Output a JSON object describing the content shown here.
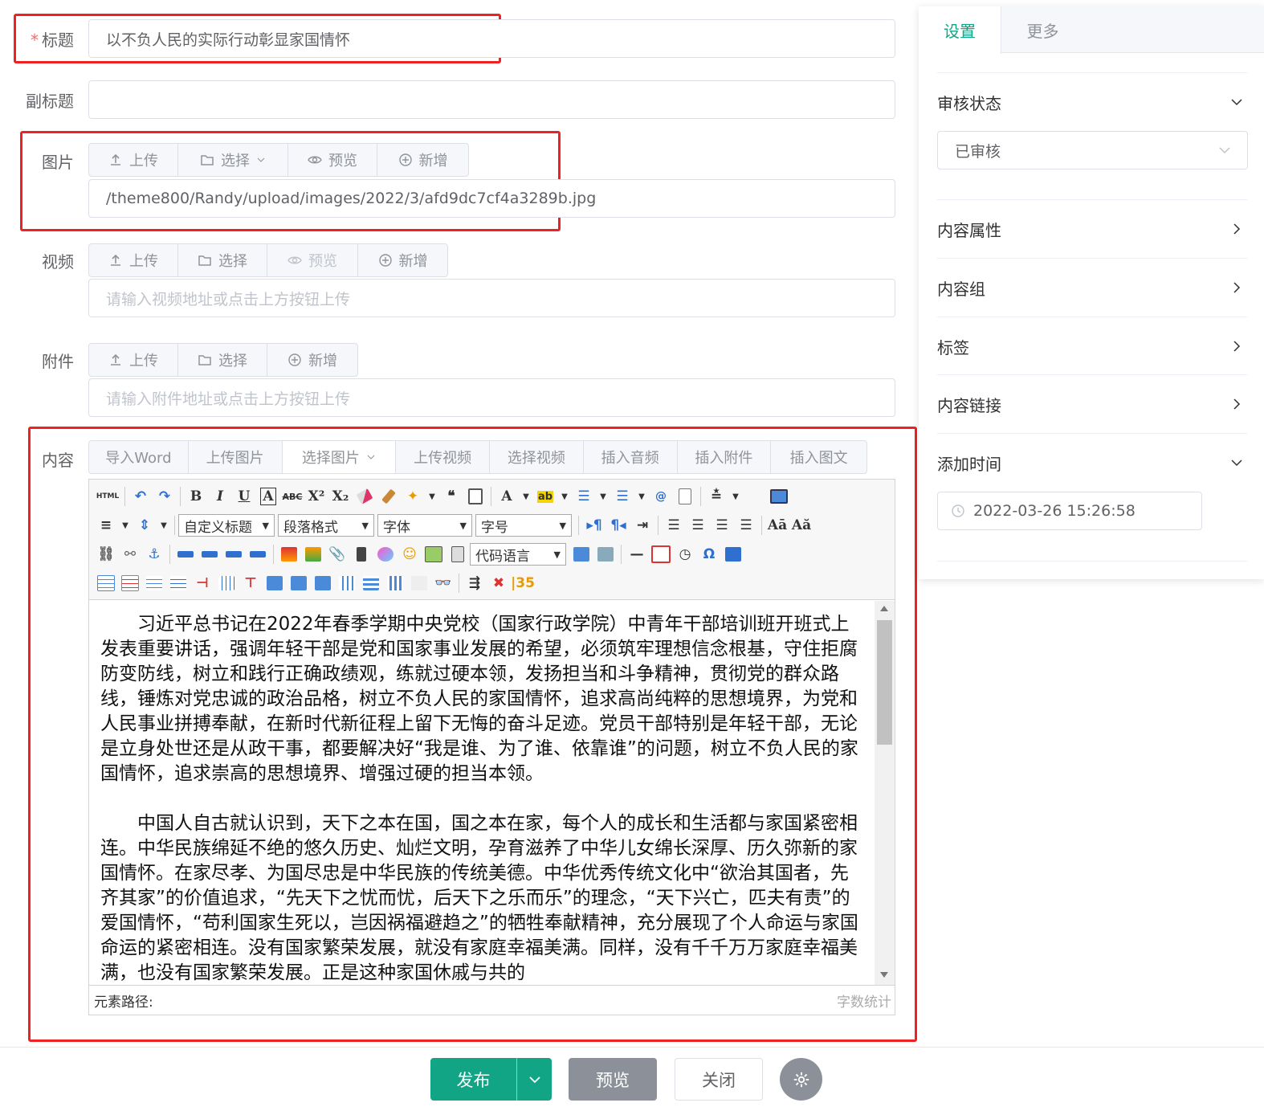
{
  "form": {
    "title": {
      "label": "标题",
      "required_mark": "*",
      "value": "以不负人民的实际行动彰显家国情怀"
    },
    "subtitle": {
      "label": "副标题",
      "value": ""
    },
    "image": {
      "label": "图片",
      "buttons": [
        "上传",
        "选择",
        "预览",
        "新增"
      ],
      "value": "/theme800/Randy/upload/images/2022/3/afd9dc7cf4a3289b.jpg"
    },
    "video": {
      "label": "视频",
      "buttons": [
        "上传",
        "选择",
        "预览",
        "新增"
      ],
      "placeholder": "请输入视频地址或点击上方按钮上传"
    },
    "attachment": {
      "label": "附件",
      "buttons": [
        "上传",
        "选择",
        "新增"
      ],
      "placeholder": "请输入附件地址或点击上方按钮上传"
    },
    "content": {
      "label": "内容",
      "tabs": [
        "导入Word",
        "上传图片",
        "选择图片",
        "上传视频",
        "选择视频",
        "插入音频",
        "插入附件",
        "插入图文"
      ],
      "combos": {
        "custom_title": "自定义标题",
        "paragraph": "段落格式",
        "font": "字体",
        "size": "字号",
        "code_lang": "代码语言"
      },
      "paragraphs": [
        "习近平总书记在2022年春季学期中央党校（国家行政学院）中青年干部培训班开班式上发表重要讲话，强调年轻干部是党和国家事业发展的希望，必须筑牢理想信念根基，守住拒腐防变防线，树立和践行正确政绩观，练就过硬本领，发扬担当和斗争精神，贯彻党的群众路线，锤炼对党忠诚的政治品格，树立不负人民的家国情怀，追求高尚纯粹的思想境界，为党和人民事业拼搏奉献，在新时代新征程上留下无悔的奋斗足迹。党员干部特别是年轻干部，无论是立身处世还是从政干事，都要解决好“我是谁、为了谁、依靠谁”的问题，树立不负人民的家国情怀，追求崇高的思想境界、增强过硬的担当本领。",
        "中国人自古就认识到，天下之本在国，国之本在家，每个人的成长和生活都与家国紧密相连。中华民族绵延不绝的悠久历史、灿烂文明，孕育滋养了中华儿女绵长深厚、历久弥新的家国情怀。在家尽孝、为国尽忠是中华民族的传统美德。中华优秀传统文化中“欲治其国者，先齐其家”的价值追求，“先天下之忧而忧，后天下之乐而乐”的理念，“天下兴亡，匹夫有责”的爱国情怀，“苟利国家生死以，岂因祸福避趋之”的牺牲奉献精神，充分展现了个人命运与家国命运的紧密相连。没有国家繁荣发展，就没有家庭幸福美满。同样，没有千千万万家庭幸福美满，也没有国家繁荣发展。正是这种家国休戚与共的"
      ],
      "status_path": "元素路径:",
      "word_count": "字数统计"
    }
  },
  "sidebar": {
    "tabs": [
      "设置",
      "更多"
    ],
    "review": {
      "label": "审核状态",
      "value": "已审核"
    },
    "items": [
      "内容属性",
      "内容组",
      "标签",
      "内容链接"
    ],
    "add_time": {
      "label": "添加时间",
      "value": "2022-03-26 15:26:58"
    }
  },
  "footer": {
    "publish": "发布",
    "preview": "预览",
    "close": "关闭"
  },
  "colors": {
    "accent": "#12a585",
    "highlight": "#e22222"
  }
}
